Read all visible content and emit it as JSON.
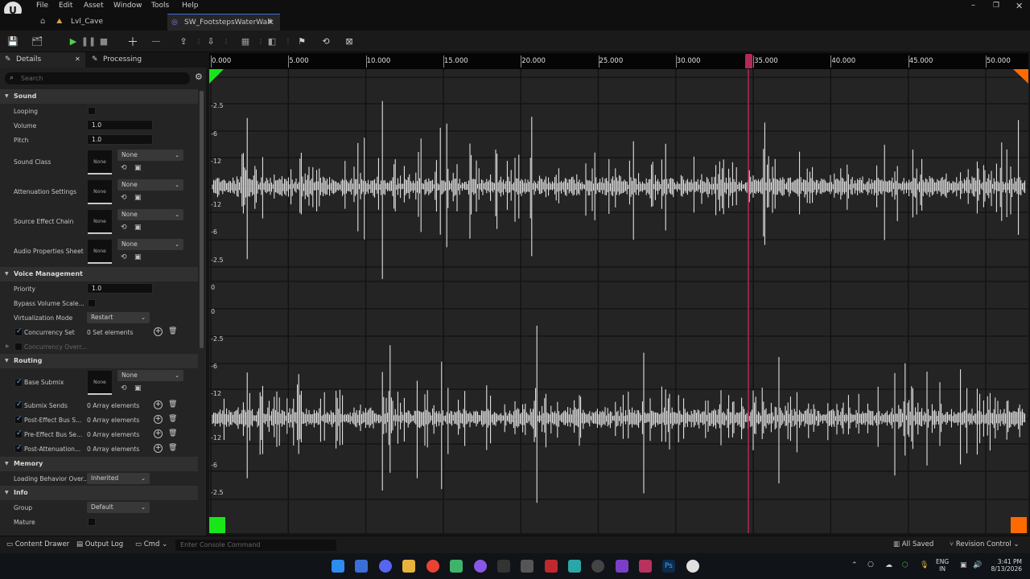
{
  "menu": [
    "File",
    "Edit",
    "Asset",
    "Window",
    "Tools",
    "Help"
  ],
  "tabs": {
    "level": "Lvl_Cave",
    "asset": "SW_FootstepsWaterWalk"
  },
  "panel_tabs": {
    "details": "Details",
    "processing": "Processing"
  },
  "search": {
    "placeholder": "Search"
  },
  "sections": {
    "sound": "Sound",
    "voice": "Voice Management",
    "routing": "Routing",
    "memory": "Memory",
    "info": "Info"
  },
  "sound": {
    "looping": "Looping",
    "volume_label": "Volume",
    "volume": "1.0",
    "pitch_label": "Pitch",
    "pitch": "1.0",
    "sound_class": "Sound Class",
    "attenuation": "Attenuation Settings",
    "source_effect": "Source Effect Chain",
    "audio_props": "Audio Properties Sheet",
    "none": "None"
  },
  "voice": {
    "priority_label": "Priority",
    "priority": "1.0",
    "bypass": "Bypass Volume Scale...",
    "virt_label": "Virtualization Mode",
    "virt": "Restart",
    "concurrency": "Concurrency Set",
    "concurrency_val": "0 Set elements",
    "concurrency_over": "Concurrency Overr..."
  },
  "routing": {
    "base_submix": "Base Submix",
    "submix_sends": "Submix Sends",
    "post_effect": "Post-Effect Bus S...",
    "pre_effect": "Pre-Effect Bus Se...",
    "post_atten": "Post-Attenuation...",
    "array_val": "0 Array elements"
  },
  "memory": {
    "loading_label": "Loading Behavior Over...",
    "loading": "Inherited"
  },
  "info": {
    "group_label": "Group",
    "group": "Default",
    "mature": "Mature"
  },
  "timeline": {
    "ticks": [
      "0.000",
      "5.000",
      "10.000",
      "15.000",
      "20.000",
      "25.000",
      "30.000",
      "35.000",
      "40.000",
      "45.000",
      "50.000"
    ],
    "playhead": "34.6"
  },
  "y_labels": [
    "-2.5",
    "-6",
    "-12",
    "-12",
    "-6",
    "-2.5",
    "0",
    "0",
    "-2.5",
    "-6",
    "-12",
    "-12",
    "-6",
    "-2.5"
  ],
  "bottom": {
    "content_drawer": "Content Drawer",
    "output_log": "Output Log",
    "cmd": "Cmd",
    "console_placeholder": "Enter Console Command",
    "all_saved": "All Saved",
    "revision": "Revision Control"
  },
  "tray": {
    "lang1": "ENG",
    "lang2": "IN",
    "time": "3:41 PM",
    "date": "8/13/2026"
  },
  "colors": {
    "accent": "#59a6ff",
    "playhead": "#b02a58",
    "start_marker": "#19e619",
    "end_marker": "#ff6a00"
  }
}
